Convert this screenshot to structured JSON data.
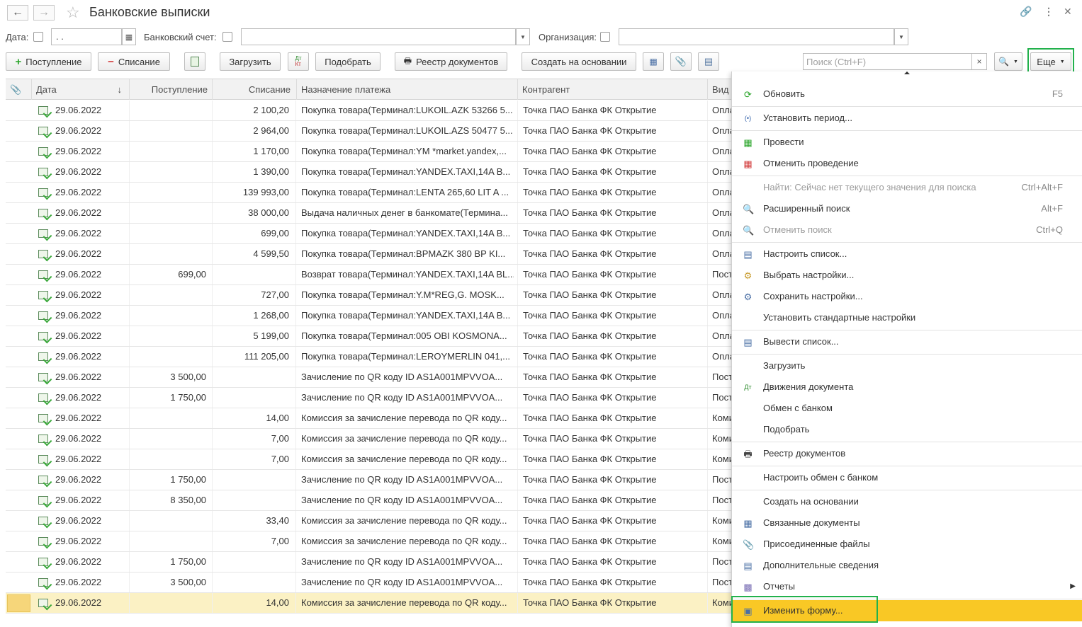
{
  "window": {
    "title": "Банковские выписки",
    "back_icon": "arrow-left-icon",
    "forward_icon": "arrow-right-icon",
    "link_icon": "link-icon",
    "more_icon": "kebab-icon",
    "close_icon": "close-icon"
  },
  "filters": {
    "date_label": "Дата:",
    "date_value": " .  .",
    "account_label": "Банковский счет:",
    "account_value": "",
    "org_label": "Организация:",
    "org_value": ""
  },
  "toolbar": {
    "receipt": "Поступление",
    "writeoff": "Списание",
    "load": "Загрузить",
    "pick": "Подобрать",
    "registry": "Реестр документов",
    "create_based": "Создать на основании",
    "search_placeholder": "Поиск (Ctrl+F)",
    "search_clear": "×",
    "more": "Еще"
  },
  "table": {
    "headers": {
      "date": "Дата",
      "sort_mark": "↓",
      "income": "Поступление",
      "outcome": "Списание",
      "purpose": "Назначение платежа",
      "counterparty": "Контрагент",
      "kind": "Вид"
    },
    "rows": [
      {
        "date": "29.06.2022",
        "income": "",
        "outcome": "2 100,20",
        "purpose": "Покупка товара(Терминал:LUKOIL.AZK 53266 5...",
        "counterparty": "Точка ПАО Банка ФК Открытие",
        "kind": "Опла"
      },
      {
        "date": "29.06.2022",
        "income": "",
        "outcome": "2 964,00",
        "purpose": "Покупка товара(Терминал:LUKOIL.AZS 50477 5...",
        "counterparty": "Точка ПАО Банка ФК Открытие",
        "kind": "Опла"
      },
      {
        "date": "29.06.2022",
        "income": "",
        "outcome": "1 170,00",
        "purpose": "Покупка товара(Терминал:YM *market.yandex,...",
        "counterparty": "Точка ПАО Банка ФК Открытие",
        "kind": "Опла"
      },
      {
        "date": "29.06.2022",
        "income": "",
        "outcome": "1 390,00",
        "purpose": "Покупка товара(Терминал:YANDEX.TAXI,14A B...",
        "counterparty": "Точка ПАО Банка ФК Открытие",
        "kind": "Опла"
      },
      {
        "date": "29.06.2022",
        "income": "",
        "outcome": "139 993,00",
        "purpose": "Покупка товара(Терминал:LENTA 265,60 LIT A ...",
        "counterparty": "Точка ПАО Банка ФК Открытие",
        "kind": "Опла"
      },
      {
        "date": "29.06.2022",
        "income": "",
        "outcome": "38 000,00",
        "purpose": "Выдача наличных денег в банкомате(Термина...",
        "counterparty": "Точка ПАО Банка ФК Открытие",
        "kind": "Опла"
      },
      {
        "date": "29.06.2022",
        "income": "",
        "outcome": "699,00",
        "purpose": "Покупка товара(Терминал:YANDEX.TAXI,14A B...",
        "counterparty": "Точка ПАО Банка ФК Открытие",
        "kind": "Опла"
      },
      {
        "date": "29.06.2022",
        "income": "",
        "outcome": "4 599,50",
        "purpose": "Покупка товара(Терминал:BPMAZK 380 BP KI...",
        "counterparty": "Точка ПАО Банка ФК Открытие",
        "kind": "Опла"
      },
      {
        "date": "29.06.2022",
        "income": "699,00",
        "outcome": "",
        "purpose": "Возврат товара(Терминал:YANDEX.TAXI,14A BL...",
        "counterparty": "Точка ПАО Банка ФК Открытие",
        "kind": "Пост"
      },
      {
        "date": "29.06.2022",
        "income": "",
        "outcome": "727,00",
        "purpose": "Покупка товара(Терминал:Y.M*REG,G. MOSK...",
        "counterparty": "Точка ПАО Банка ФК Открытие",
        "kind": "Опла"
      },
      {
        "date": "29.06.2022",
        "income": "",
        "outcome": "1 268,00",
        "purpose": "Покупка товара(Терминал:YANDEX.TAXI,14A B...",
        "counterparty": "Точка ПАО Банка ФК Открытие",
        "kind": "Опла"
      },
      {
        "date": "29.06.2022",
        "income": "",
        "outcome": "5 199,00",
        "purpose": "Покупка товара(Терминал:005 OBI KOSMONA...",
        "counterparty": "Точка ПАО Банка ФК Открытие",
        "kind": "Опла"
      },
      {
        "date": "29.06.2022",
        "income": "",
        "outcome": "111 205,00",
        "purpose": "Покупка товара(Терминал:LEROYMERLIN 041,...",
        "counterparty": "Точка ПАО Банка ФК Открытие",
        "kind": "Опла"
      },
      {
        "date": "29.06.2022",
        "income": "3 500,00",
        "outcome": "",
        "purpose": "Зачисление по QR коду ID AS1A001MPVVOA...",
        "counterparty": "Точка ПАО Банка ФК Открытие",
        "kind": "Пост"
      },
      {
        "date": "29.06.2022",
        "income": "1 750,00",
        "outcome": "",
        "purpose": "Зачисление по QR коду ID AS1A001MPVVOA...",
        "counterparty": "Точка ПАО Банка ФК Открытие",
        "kind": "Пост"
      },
      {
        "date": "29.06.2022",
        "income": "",
        "outcome": "14,00",
        "purpose": "Комиссия за зачисление перевода по QR коду...",
        "counterparty": "Точка ПАО Банка ФК Открытие",
        "kind": "Коми"
      },
      {
        "date": "29.06.2022",
        "income": "",
        "outcome": "7,00",
        "purpose": "Комиссия за зачисление перевода по QR коду...",
        "counterparty": "Точка ПАО Банка ФК Открытие",
        "kind": "Коми"
      },
      {
        "date": "29.06.2022",
        "income": "",
        "outcome": "7,00",
        "purpose": "Комиссия за зачисление перевода по QR коду...",
        "counterparty": "Точка ПАО Банка ФК Открытие",
        "kind": "Коми"
      },
      {
        "date": "29.06.2022",
        "income": "1 750,00",
        "outcome": "",
        "purpose": "Зачисление по QR коду ID AS1A001MPVVOA...",
        "counterparty": "Точка ПАО Банка ФК Открытие",
        "kind": "Пост"
      },
      {
        "date": "29.06.2022",
        "income": "8 350,00",
        "outcome": "",
        "purpose": "Зачисление по QR коду ID AS1A001MPVVOA...",
        "counterparty": "Точка ПАО Банка ФК Открытие",
        "kind": "Пост"
      },
      {
        "date": "29.06.2022",
        "income": "",
        "outcome": "33,40",
        "purpose": "Комиссия за зачисление перевода по QR коду...",
        "counterparty": "Точка ПАО Банка ФК Открытие",
        "kind": "Коми"
      },
      {
        "date": "29.06.2022",
        "income": "",
        "outcome": "7,00",
        "purpose": "Комиссия за зачисление перевода по QR коду...",
        "counterparty": "Точка ПАО Банка ФК Открытие",
        "kind": "Коми"
      },
      {
        "date": "29.06.2022",
        "income": "1 750,00",
        "outcome": "",
        "purpose": "Зачисление по QR коду ID AS1A001MPVVOA...",
        "counterparty": "Точка ПАО Банка ФК Открытие",
        "kind": "Пост"
      },
      {
        "date": "29.06.2022",
        "income": "3 500,00",
        "outcome": "",
        "purpose": "Зачисление по QR коду ID AS1A001MPVVOA...",
        "counterparty": "Точка ПАО Банка ФК Открытие",
        "kind": "Пост"
      },
      {
        "date": "29.06.2022",
        "income": "",
        "outcome": "14,00",
        "purpose": "Комиссия за зачисление перевода по QR коду...",
        "counterparty": "Точка ПАО Банка ФК Открытие",
        "kind": "Коми",
        "selected": true
      }
    ]
  },
  "menu": {
    "items": [
      {
        "label": "Обновить",
        "shortcut": "F5",
        "icon": "refresh-icon",
        "sep_after": true
      },
      {
        "label": "Установить период...",
        "shortcut": "",
        "icon": "period-icon",
        "sep_after": true
      },
      {
        "label": "Провести",
        "shortcut": "",
        "icon": "post-document-icon",
        "sep_after": false
      },
      {
        "label": "Отменить проведение",
        "shortcut": "",
        "icon": "unpost-document-icon",
        "sep_after": true
      },
      {
        "label": "Найти: Сейчас нет текущего значения для поиска",
        "shortcut": "Ctrl+Alt+F",
        "icon": "",
        "disabled": true,
        "sep_after": false
      },
      {
        "label": "Расширенный поиск",
        "shortcut": "Alt+F",
        "icon": "search-icon",
        "sep_after": false
      },
      {
        "label": "Отменить поиск",
        "shortcut": "Ctrl+Q",
        "icon": "cancel-search-icon",
        "disabled": true,
        "sep_after": true
      },
      {
        "label": "Настроить список...",
        "shortcut": "",
        "icon": "list-settings-icon",
        "sep_after": false
      },
      {
        "label": "Выбрать настройки...",
        "shortcut": "",
        "icon": "choose-settings-icon",
        "sep_after": false
      },
      {
        "label": "Сохранить настройки...",
        "shortcut": "",
        "icon": "save-settings-icon",
        "sep_after": false
      },
      {
        "label": "Установить стандартные настройки",
        "shortcut": "",
        "icon": "",
        "sep_after": true
      },
      {
        "label": "Вывести список...",
        "shortcut": "",
        "icon": "export-list-icon",
        "sep_after": true
      },
      {
        "label": "Загрузить",
        "shortcut": "",
        "icon": "",
        "sep_after": false
      },
      {
        "label": "Движения документа",
        "shortcut": "",
        "icon": "dt-kt-icon",
        "sep_after": false
      },
      {
        "label": "Обмен с банком",
        "shortcut": "",
        "icon": "",
        "sep_after": false
      },
      {
        "label": "Подобрать",
        "shortcut": "",
        "icon": "",
        "sep_after": true
      },
      {
        "label": "Реестр документов",
        "shortcut": "",
        "icon": "printer-icon",
        "sep_after": true
      },
      {
        "label": "Настроить обмен с банком",
        "shortcut": "",
        "icon": "",
        "sep_after": true
      },
      {
        "label": "Создать на основании",
        "shortcut": "",
        "icon": "",
        "sep_after": false
      },
      {
        "label": "Связанные документы",
        "shortcut": "",
        "icon": "related-docs-icon",
        "sep_after": false
      },
      {
        "label": "Присоединенные файлы",
        "shortcut": "",
        "icon": "paperclip-icon",
        "sep_after": false
      },
      {
        "label": "Дополнительные сведения",
        "shortcut": "",
        "icon": "info-list-icon",
        "sep_after": false
      },
      {
        "label": "Отчеты",
        "shortcut": "",
        "icon": "reports-icon",
        "submenu": true,
        "sep_after": true
      },
      {
        "label": "Изменить форму...",
        "shortcut": "",
        "icon": "form-edit-icon",
        "highlighted": true,
        "sep_after": false
      }
    ]
  }
}
